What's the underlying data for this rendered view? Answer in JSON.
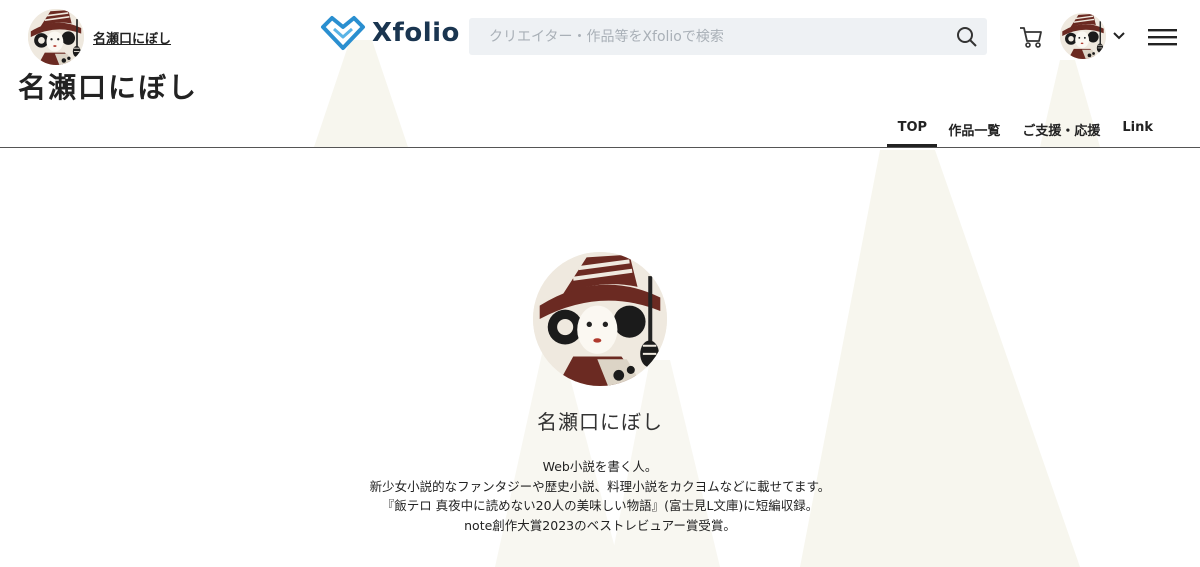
{
  "header": {
    "creator_name": "名瀬口にぼし",
    "logo_text": "Xfolio",
    "search_placeholder": "クリエイター・作品等をXfolioで検索",
    "icons": [
      "search-icon",
      "cart-icon",
      "chevron-down-icon",
      "hamburger-menu-icon"
    ]
  },
  "page_title": "名瀬口にぼし",
  "tabs": [
    {
      "label": "TOP",
      "active": true
    },
    {
      "label": "作品一覧",
      "active": false
    },
    {
      "label": "ご支援・応援",
      "active": false
    },
    {
      "label": "Link",
      "active": false
    }
  ],
  "profile": {
    "name": "名瀬口にぼし",
    "bio": [
      "Web小説を書く人。",
      "新少女小説的なファンタジーや歴史小説、料理小説をカクヨムなどに載せてます。",
      "『飯テロ 真夜中に読めない20人の美味しい物語』(富士見L文庫)に短編収録。",
      "note創作大賞2023のベストレビュアー賞受賞。"
    ]
  },
  "colors": {
    "logo_blue": "#2a8fd0",
    "logo_text": "#1a3550",
    "search_bg": "#eef1f4",
    "beam": "#f7f6ef",
    "avatar_brown": "#6b2a22"
  }
}
